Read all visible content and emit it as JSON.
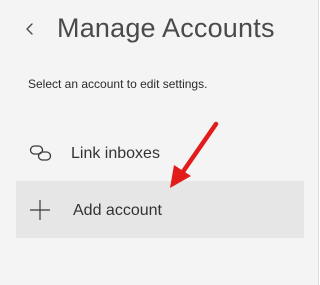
{
  "header": {
    "back_icon": "chevron-left-icon",
    "title": "Manage Accounts"
  },
  "instructions": "Select an account to edit settings.",
  "menu": {
    "items": [
      {
        "id": "link-inboxes",
        "label": "Link inboxes",
        "icon": "link-icon"
      },
      {
        "id": "add-account",
        "label": "Add account",
        "icon": "plus-icon",
        "highlighted": true
      }
    ]
  },
  "annotation": {
    "type": "arrow",
    "color": "#e21b1b",
    "points_to": "add-account"
  },
  "colors": {
    "panel_bg": "#f4f4f4",
    "highlight_bg": "#e6e6e6",
    "text": "#333333",
    "title_text": "#4a4a4a"
  }
}
